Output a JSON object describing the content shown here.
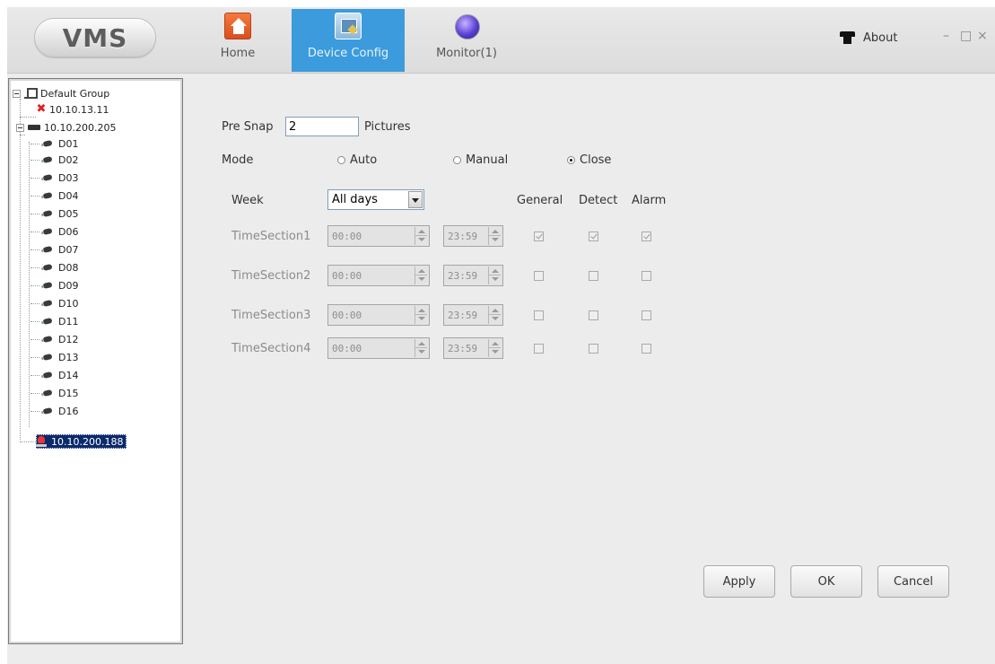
{
  "app": {
    "logo_text": "VMS"
  },
  "nav": {
    "tabs": [
      {
        "label": "Home",
        "icon": "home-icon",
        "active": false
      },
      {
        "label": "Device Config",
        "icon": "device-config-icon",
        "active": true
      },
      {
        "label": "Monitor(1)",
        "icon": "monitor-icon",
        "active": false
      }
    ],
    "about_label": "About",
    "window_controls": {
      "minimize": "–",
      "maximize": "□",
      "close": "×"
    }
  },
  "tree": {
    "group_label": "Default Group",
    "device_offline": "10.10.13.11",
    "device_dvr": "10.10.200.205",
    "channels": [
      "D01",
      "D02",
      "D03",
      "D04",
      "D05",
      "D06",
      "D07",
      "D08",
      "D09",
      "D10",
      "D11",
      "D12",
      "D13",
      "D14",
      "D15",
      "D16"
    ],
    "device_selected": "10.10.200.188"
  },
  "form": {
    "pre_snap_label": "Pre Snap",
    "pre_snap_value": "2",
    "pictures_label": "Pictures",
    "mode_label": "Mode",
    "mode_options": [
      "Auto",
      "Manual",
      "Close"
    ],
    "mode_selected": "Close",
    "week_label": "Week",
    "week_value": "All days",
    "col_headers": [
      "General",
      "Detect",
      "Alarm"
    ],
    "sections": [
      {
        "label": "TimeSection1",
        "start": "00:00",
        "end": "23:59",
        "general": true,
        "detect": true,
        "alarm": true
      },
      {
        "label": "TimeSection2",
        "start": "00:00",
        "end": "23:59",
        "general": false,
        "detect": false,
        "alarm": false
      },
      {
        "label": "TimeSection3",
        "start": "00:00",
        "end": "23:59",
        "general": false,
        "detect": false,
        "alarm": false
      },
      {
        "label": "TimeSection4",
        "start": "00:00",
        "end": "23:59",
        "general": false,
        "detect": false,
        "alarm": false
      }
    ],
    "buttons": {
      "apply": "Apply",
      "ok": "OK",
      "cancel": "Cancel"
    }
  },
  "colors": {
    "active_tab": "#3b9bdc",
    "selected_row": "#0b2a6b",
    "offline_mark": "#e0201f"
  }
}
